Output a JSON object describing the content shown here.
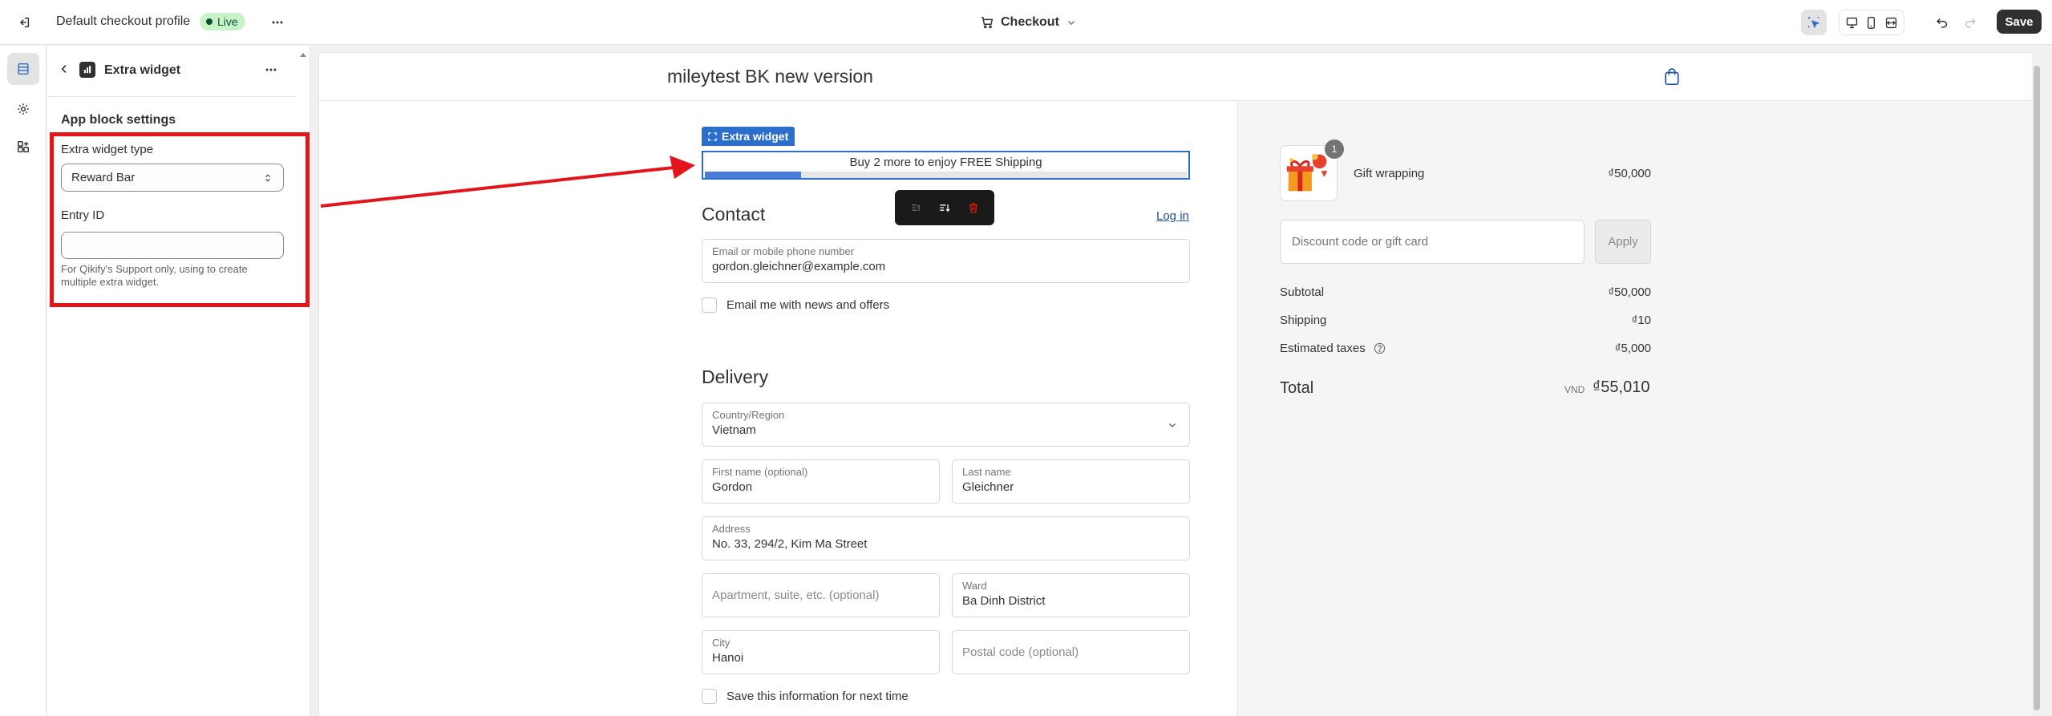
{
  "topbar": {
    "profile_name": "Default checkout profile",
    "status_badge": "Live",
    "page_selector": "Checkout",
    "save_label": "Save"
  },
  "panel": {
    "title": "Extra widget",
    "section_heading": "App block settings",
    "widget_type_label": "Extra widget type",
    "widget_type_value": "Reward Bar",
    "entry_id_label": "Entry ID",
    "entry_id_value": "",
    "entry_id_help": "For Qikify's Support only, using to create multiple extra widget."
  },
  "preview": {
    "store_name": "mileytest BK new version",
    "widget_tag": "Extra widget",
    "reward_text": "Buy 2 more to enjoy FREE Shipping",
    "reward_progress": 0.2,
    "contact": {
      "heading": "Contact",
      "login_link": "Log in",
      "email_label": "Email or mobile phone number",
      "email_value": "gordon.gleichner@example.com",
      "newsletter_label": "Email me with news and offers"
    },
    "delivery": {
      "heading": "Delivery",
      "country_label": "Country/Region",
      "country_value": "Vietnam",
      "first_name_label": "First name (optional)",
      "first_name_value": "Gordon",
      "last_name_label": "Last name",
      "last_name_value": "Gleichner",
      "address_label": "Address",
      "address_value": "No. 33, 294/2, Kim Ma Street",
      "apartment_placeholder": "Apartment, suite, etc. (optional)",
      "ward_label": "Ward",
      "ward_value": "Ba Dinh District",
      "city_label": "City",
      "city_value": "Hanoi",
      "postal_placeholder": "Postal code (optional)",
      "save_info_label": "Save this information for next time"
    },
    "summary": {
      "item_qty": "1",
      "item_name": "Gift wrapping",
      "item_price": "₫50,000",
      "discount_placeholder": "Discount code or gift card",
      "apply_label": "Apply",
      "subtotal_label": "Subtotal",
      "subtotal_value": "₫50,000",
      "shipping_label": "Shipping",
      "shipping_value": "₫10",
      "taxes_label": "Estimated taxes",
      "taxes_value": "₫5,000",
      "total_label": "Total",
      "total_currency": "VND",
      "total_value": "₫55,010"
    }
  },
  "colors": {
    "accent": "#2c6ecb",
    "highlight": "#e3141b",
    "live_badge": "#c8f3c9",
    "save_button": "#303030"
  },
  "icons": [
    "exit-icon",
    "more-horizontal-icon",
    "cart-icon",
    "chevron-down-icon",
    "inspector-icon",
    "desktop-icon",
    "mobile-icon",
    "fullwidth-icon",
    "undo-icon",
    "redo-icon",
    "sections-icon",
    "settings-icon",
    "apps-icon",
    "back-icon",
    "app-icon",
    "select-arrows-icon",
    "bag-icon",
    "move-icon",
    "reorder-icon",
    "trash-icon",
    "help-icon"
  ]
}
